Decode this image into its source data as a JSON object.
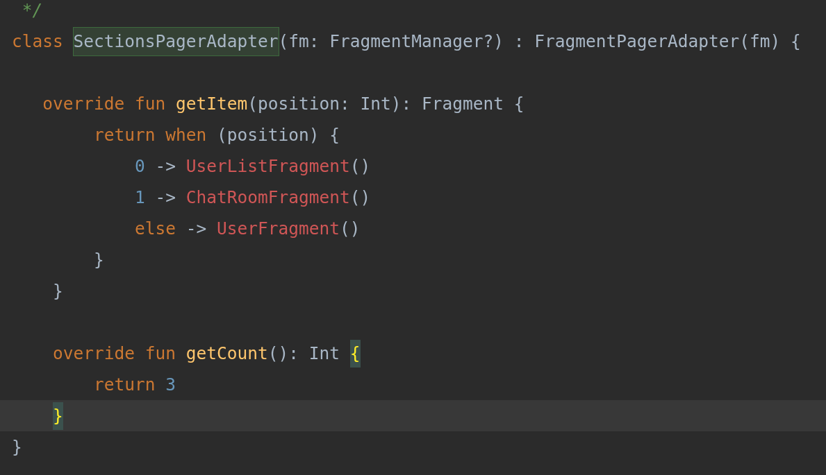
{
  "editor": {
    "lines": [
      {
        "kind": "code",
        "current": false,
        "tokens": [
          {
            "kind": "comment",
            "text": " */"
          }
        ]
      },
      {
        "kind": "code",
        "current": false,
        "tokens": [
          {
            "kind": "keyword",
            "text": "class "
          },
          {
            "kind": "declaration",
            "text": "SectionsPagerAdapter"
          },
          {
            "kind": "plain",
            "text": "(fm: FragmentManager?) : FragmentPagerAdapter(fm) {"
          }
        ]
      },
      {
        "kind": "blank",
        "current": false
      },
      {
        "kind": "code",
        "current": false,
        "tokens": [
          {
            "kind": "keyword",
            "text": "   override fun "
          },
          {
            "kind": "function",
            "text": "getItem"
          },
          {
            "kind": "plain",
            "text": "(position: Int): Fragment {"
          }
        ]
      },
      {
        "kind": "code",
        "current": false,
        "tokens": [
          {
            "kind": "keyword",
            "text": "        return when "
          },
          {
            "kind": "plain",
            "text": "(position) {"
          }
        ]
      },
      {
        "kind": "code",
        "current": false,
        "tokens": [
          {
            "kind": "number",
            "text": "            0"
          },
          {
            "kind": "plain",
            "text": " -> "
          },
          {
            "kind": "reference",
            "text": "UserListFragment"
          },
          {
            "kind": "plain",
            "text": "()"
          }
        ]
      },
      {
        "kind": "code",
        "current": false,
        "tokens": [
          {
            "kind": "number",
            "text": "            1"
          },
          {
            "kind": "plain",
            "text": " -> "
          },
          {
            "kind": "reference",
            "text": "ChatRoomFragment"
          },
          {
            "kind": "plain",
            "text": "()"
          }
        ]
      },
      {
        "kind": "code",
        "current": false,
        "tokens": [
          {
            "kind": "keyword",
            "text": "            else"
          },
          {
            "kind": "plain",
            "text": " -> "
          },
          {
            "kind": "reference",
            "text": "UserFragment"
          },
          {
            "kind": "plain",
            "text": "()"
          }
        ]
      },
      {
        "kind": "code",
        "current": false,
        "tokens": [
          {
            "kind": "plain",
            "text": "        }"
          }
        ]
      },
      {
        "kind": "code",
        "current": false,
        "tokens": [
          {
            "kind": "plain",
            "text": "    }"
          }
        ]
      },
      {
        "kind": "blank",
        "current": false
      },
      {
        "kind": "code",
        "current": false,
        "tokens": [
          {
            "kind": "keyword",
            "text": "    override fun "
          },
          {
            "kind": "function",
            "text": "getCount"
          },
          {
            "kind": "plain",
            "text": "(): Int "
          },
          {
            "kind": "brace",
            "text": "{"
          }
        ]
      },
      {
        "kind": "code",
        "current": false,
        "tokens": [
          {
            "kind": "keyword",
            "text": "        return "
          },
          {
            "kind": "number",
            "text": "3"
          }
        ]
      },
      {
        "kind": "code",
        "current": true,
        "tokens": [
          {
            "kind": "brace",
            "text": "    }"
          }
        ]
      },
      {
        "kind": "code",
        "current": false,
        "tokens": [
          {
            "kind": "plain",
            "text": "}"
          }
        ]
      }
    ]
  }
}
